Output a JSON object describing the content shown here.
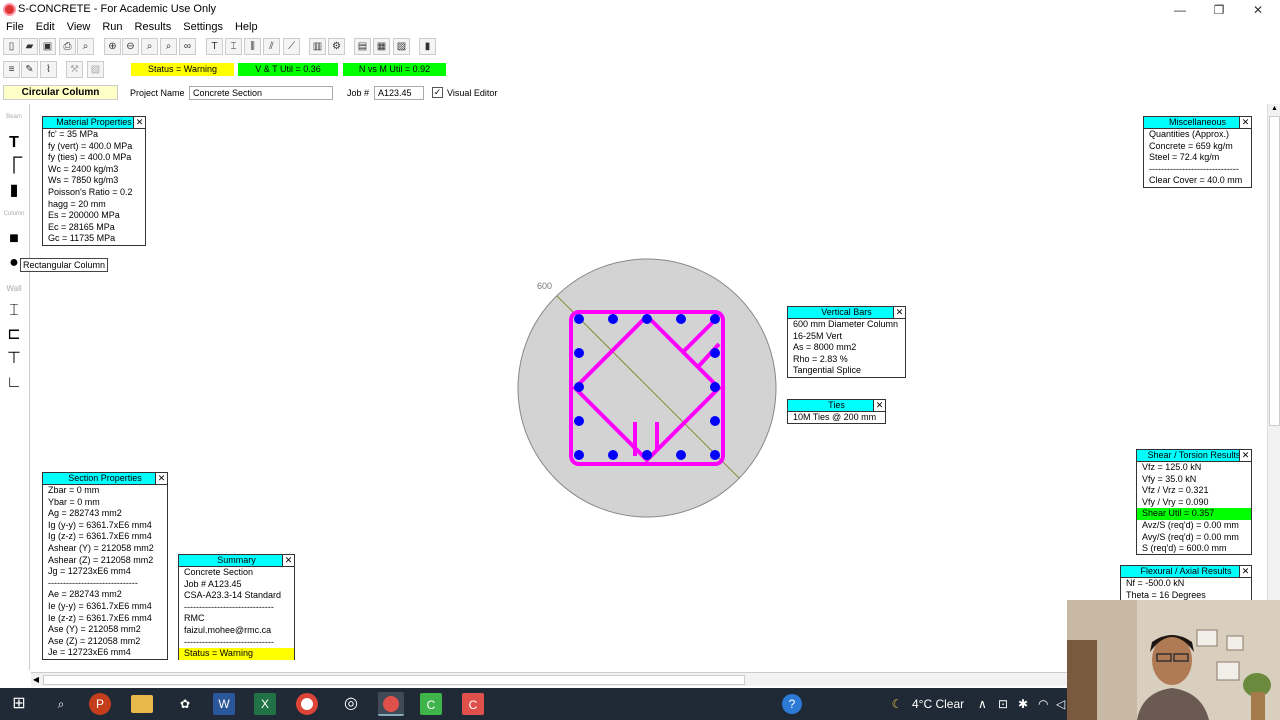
{
  "window": {
    "title": "S-CONCRETE - For Academic Use Only"
  },
  "menu": [
    "File",
    "Edit",
    "View",
    "Run",
    "Results",
    "Settings",
    "Help"
  ],
  "status_bar": {
    "status": "Status = Warning",
    "vt_util": "V & T Util = 0.36",
    "nm_util": "N vs M Util = 0.92",
    "colors": {
      "warning": "#ffff00",
      "ok": "#00ff00"
    }
  },
  "project": {
    "mode": "Circular Column",
    "project_name_label": "Project Name",
    "project_name_value": "Concrete Section",
    "job_label": "Job #",
    "job_value": "A123.45",
    "visual_editor_label": "Visual Editor",
    "visual_editor_checked": true
  },
  "left_strip": {
    "beam_label": "Beam",
    "column_label": "Column",
    "wall_label": "Wall",
    "tooltip": "Rectangular Column"
  },
  "panels": {
    "material": {
      "title": "Material Properties",
      "rows": [
        "fc' = 35 MPa",
        "fy (vert) = 400.0 MPa",
        "fy (ties) = 400.0 MPa",
        "Wc = 2400 kg/m3",
        "Ws = 7850 kg/m3",
        "Poisson's Ratio = 0.2",
        "hagg = 20 mm",
        "Es = 200000 MPa",
        "Ec = 28165 MPa",
        "Gc = 11735 MPa"
      ]
    },
    "misc": {
      "title": "Miscellaneous",
      "rows": [
        "Quantities (Approx.)",
        "Concrete = 659 kg/m",
        "Steel = 72.4 kg/m",
        "------------------------------",
        "Clear Cover = 40.0 mm"
      ]
    },
    "vertical_bars": {
      "title": "Vertical Bars",
      "rows": [
        "600 mm Diameter Column",
        "16-25M Vert",
        "As = 8000 mm2",
        "Rho = 2.83 %",
        "Tangential Splice"
      ]
    },
    "ties": {
      "title": "Ties",
      "rows": [
        "10M Ties @ 200 mm"
      ]
    },
    "section": {
      "title": "Section Properties",
      "rows": [
        "Zbar = 0 mm",
        "Ybar = 0 mm",
        "Ag = 282743 mm2",
        "Ig (y-y) = 6361.7xE6 mm4",
        "Ig (z-z) = 6361.7xE6 mm4",
        "Ashear (Y) = 212058 mm2",
        "Ashear (Z) = 212058 mm2",
        "Jg = 12723xE6 mm4",
        "------------------------------",
        "Ae = 282743 mm2",
        "Ie (y-y) = 6361.7xE6 mm4",
        "Ie (z-z) = 6361.7xE6 mm4",
        "Ase (Y) = 212058 mm2",
        "Ase (Z) = 212058 mm2",
        "Je = 12723xE6 mm4"
      ]
    },
    "summary": {
      "title": "Summary",
      "rows": [
        "Concrete Section",
        "Job # A123.45",
        "CSA-A23.3-14 Standard",
        "------------------------------",
        "RMC",
        "faizul.mohee@rmc.ca",
        "------------------------------",
        "Status = Warning"
      ]
    },
    "shear": {
      "title": "Shear / Torsion Results",
      "rows": [
        "Vfz = 125.0 kN",
        "Vfy = 35.0 kN",
        "Vfz / Vrz = 0.321",
        "Vfy / Vry = 0.090",
        "Shear Util = 0.357",
        "Avz/S (req'd) = 0.00 mm",
        "Avy/S (req'd) = 0.00 mm",
        "S (req'd) = 600.0 mm"
      ]
    },
    "flexural": {
      "title": "Flexural / Axial Results",
      "rows": [
        "Nf = -500.0 kN",
        "Theta = 16 Degrees"
      ]
    }
  },
  "drawing": {
    "dimension_label": "600",
    "bar_count": 16,
    "concrete_color": "#d3d3d3",
    "tie_color": "#ff00ff",
    "bar_color": "#0000ff"
  },
  "taskbar": {
    "weather": "4°C  Clear"
  }
}
